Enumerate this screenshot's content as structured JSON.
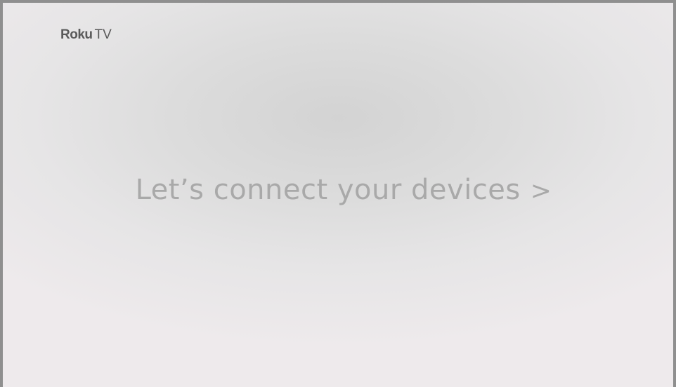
{
  "brand": {
    "name": "Roku",
    "suffix": "TV"
  },
  "main": {
    "prompt": "Let’s connect your devices",
    "chevron": ">"
  },
  "colors": {
    "background": "#dcdcdc",
    "text": "#a9a9a9",
    "logo": "#5a5a5a",
    "frame": "#8f8f8f"
  },
  "icons": {
    "chevron": "chevron-right-icon"
  }
}
